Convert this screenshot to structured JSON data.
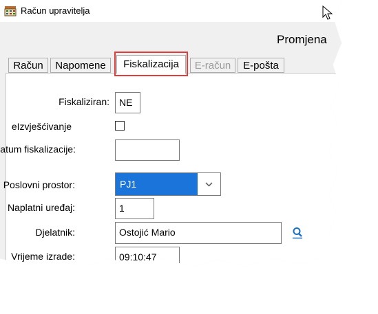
{
  "window": {
    "title": "Račun upravitelja"
  },
  "header": {
    "text": "Promjena"
  },
  "tabs": [
    {
      "label": "Račun"
    },
    {
      "label": "Napomene"
    },
    {
      "label": "Fiskalizacija"
    },
    {
      "label": "E-račun"
    },
    {
      "label": "E-pošta"
    }
  ],
  "form": {
    "fiskaliziran_label": "Fiskaliziran:",
    "fiskaliziran_value": "NE",
    "eizvjescivanje_label": "eIzvješćivanje",
    "datum_label": "Datum fiskalizacije:",
    "datum_value": "",
    "poslovni_prostor_label": "Poslovni prostor:",
    "poslovni_prostor_value": "PJ1",
    "naplatni_uredaj_label": "Naplatni uređaj:",
    "naplatni_uredaj_value": "1",
    "djelatnik_label": "Djelatnik:",
    "djelatnik_value": "Ostojić Mario",
    "vrijeme_label": "Vrijeme izrade:",
    "vrijeme_value": "09:10:47"
  },
  "colors": {
    "highlight": "#e03c3c",
    "selection": "#1a74d9",
    "lookup_icon": "#1a6fc0"
  },
  "icons": {
    "window": "cash-register-icon",
    "lookup": "search-user-icon",
    "dropdown": "chevron-down-icon"
  }
}
